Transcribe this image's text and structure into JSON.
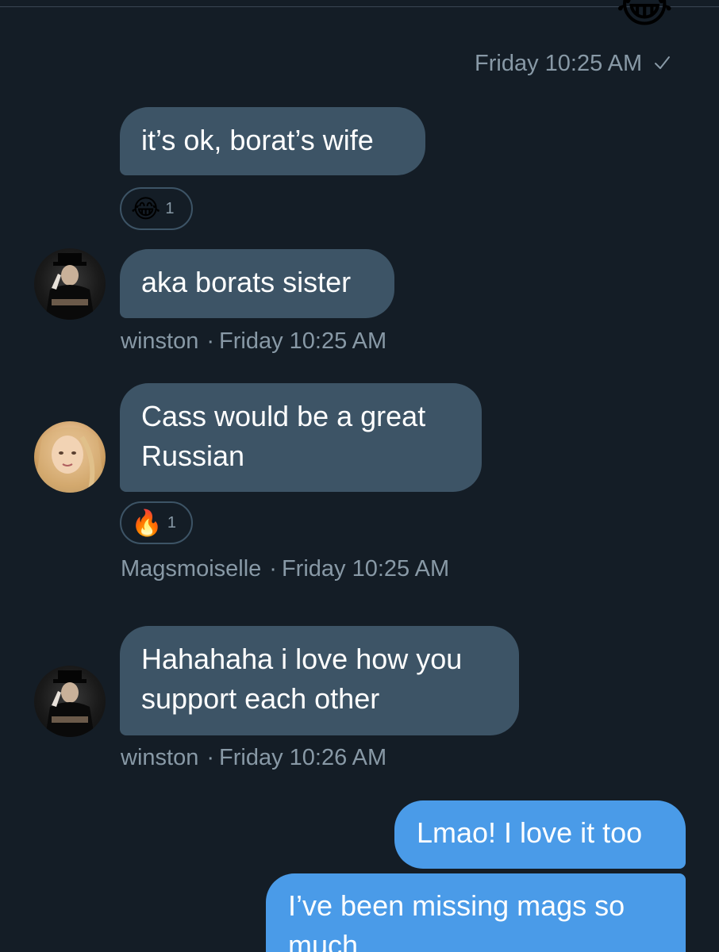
{
  "conversation": {
    "top_partial_emoji": "😂",
    "top_timestamp": "Friday 10:25 AM",
    "messages": [
      {
        "text": "it’s ok, borat’s wife",
        "reaction": {
          "emoji": "😂",
          "count": "1"
        }
      },
      {
        "text": "aka borats sister",
        "sender": "winston",
        "time": "Friday 10:25 AM"
      },
      {
        "text": "Cass would be a great Russian",
        "reaction": {
          "emoji": "🔥",
          "count": "1"
        },
        "sender": "Magsmoiselle",
        "time": "Friday 10:25 AM"
      },
      {
        "text": "Hahahaha i love how you support each other",
        "sender": "winston",
        "time": "Friday 10:26 AM"
      },
      {
        "text": "Lmao! I love it too"
      },
      {
        "text": "I’ve been missing mags so much"
      }
    ]
  },
  "meta": {
    "separator": "·"
  },
  "colors": {
    "background": "#141d26",
    "incoming_bubble": "#3d5466",
    "outgoing_bubble": "#4a9be8",
    "meta_text": "#8899a6"
  },
  "icons": {
    "read_receipt": "checkmark-icon",
    "avatar_winston": "user-avatar-winston",
    "avatar_mags": "user-avatar-magsmoiselle"
  }
}
